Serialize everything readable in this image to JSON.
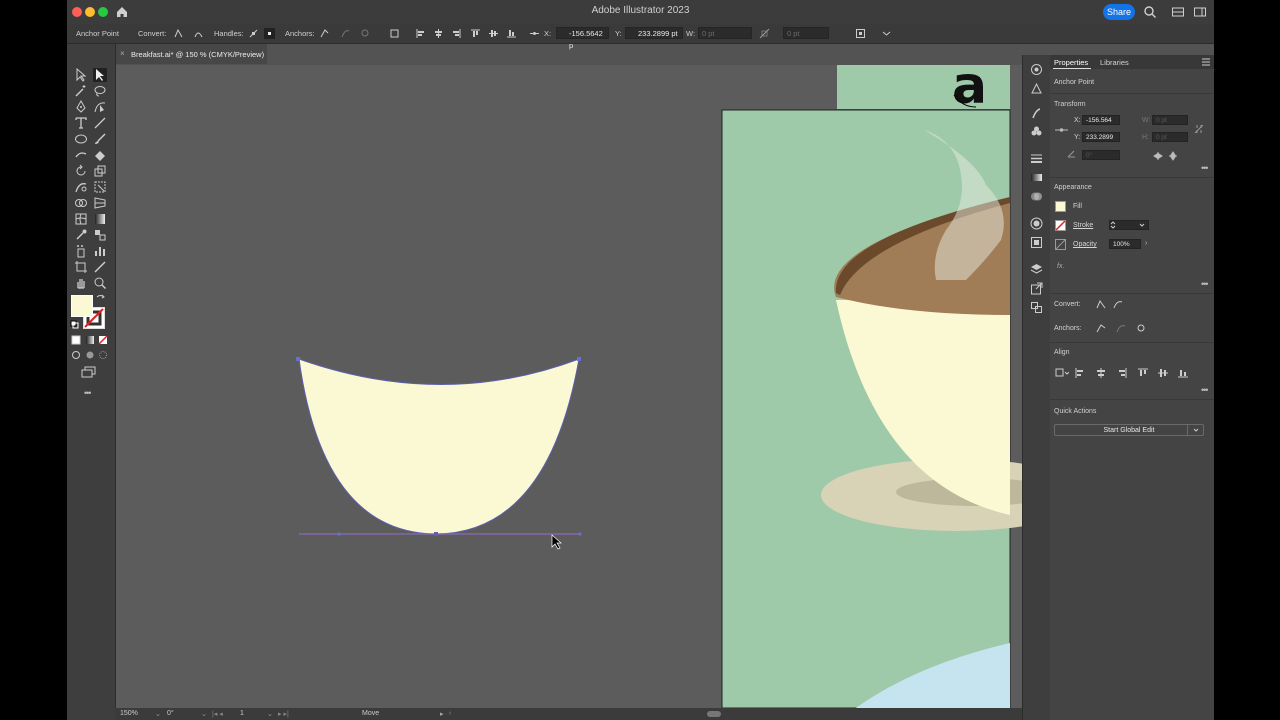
{
  "app": {
    "title": "Adobe Illustrator 2023",
    "share_label": "Share"
  },
  "controlbar": {
    "tool_name": "Anchor Point",
    "convert_label": "Convert:",
    "handles_label": "Handles:",
    "anchors_label": "Anchors:",
    "x_label": "X:",
    "x_value": "-156.5642 p",
    "y_label": "Y:",
    "y_value": "233.2899 pt",
    "w_label": "W:",
    "w_value": "0 pt",
    "h_value": "0 pt"
  },
  "document": {
    "tab_label": "Breakfast.ai* @ 150 % (CMYK/Preview)",
    "close_glyph": "×"
  },
  "canvas": {
    "artboard_letter": "a",
    "fill_color": "#fbf9d3",
    "bg_color": "#9ecaa9"
  },
  "statusbar": {
    "zoom": "150%",
    "rotation": "0°",
    "artboard_number": "1",
    "tool_status": "Move"
  },
  "properties": {
    "tab_properties": "Properties",
    "tab_libraries": "Libraries",
    "selection_type": "Anchor Point",
    "transform": {
      "title": "Transform",
      "x_label": "X:",
      "x_value": "-156.564",
      "y_label": "Y:",
      "y_value": "233.2899",
      "w_label": "W:",
      "w_value": "0 pt",
      "h_label": "H:",
      "h_value": "0 pt",
      "angle_value": "0°"
    },
    "appearance": {
      "title": "Appearance",
      "fill_label": "Fill",
      "stroke_label": "Stroke",
      "opacity_label": "Opacity",
      "opacity_value": "100%",
      "fx_label": "fx."
    },
    "convert_label": "Convert:",
    "anchors_label": "Anchors:",
    "align_title": "Align",
    "quick_actions_title": "Quick Actions",
    "global_edit_label": "Start Global Edit"
  }
}
